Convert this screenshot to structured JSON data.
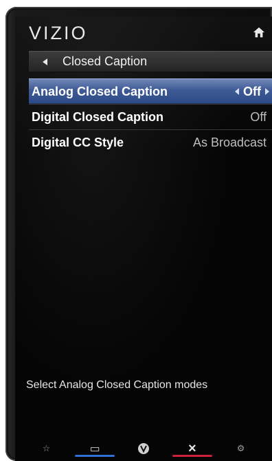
{
  "header": {
    "logo": "VIZIO",
    "home_icon": "home-icon"
  },
  "title_bar": {
    "back_icon": "left-triangle-icon",
    "title": "Closed Caption"
  },
  "menu": {
    "items": [
      {
        "label": "Analog Closed Caption",
        "value": "Off",
        "selected": true
      },
      {
        "label": "Digital Closed Caption",
        "value": "Off",
        "selected": false
      },
      {
        "label": "Digital CC Style",
        "value": "As Broadcast",
        "selected": false
      }
    ]
  },
  "help_text": "Select Analog Closed Caption modes",
  "footer": {
    "icons": [
      {
        "name": "star-icon",
        "glyph": "☆",
        "bar_color": ""
      },
      {
        "name": "input-icon",
        "glyph": "▭",
        "bar_color": "#2f6fd6"
      },
      {
        "name": "vizio-v-icon",
        "glyph": "V",
        "bar_color": ""
      },
      {
        "name": "close-icon",
        "glyph": "×",
        "bar_color": "#d2203a"
      },
      {
        "name": "settings-icon",
        "glyph": "⚙",
        "bar_color": ""
      }
    ]
  },
  "colors": {
    "selected_row": "#3e5a95",
    "input_bar": "#2f6fd6",
    "exit_bar": "#d2203a"
  }
}
